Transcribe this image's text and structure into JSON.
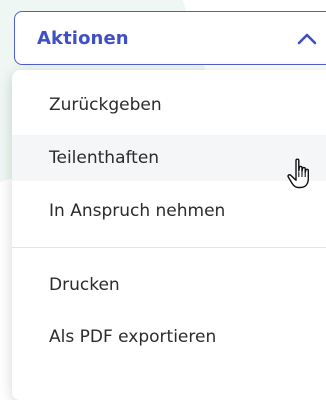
{
  "dropdown": {
    "label": "Aktionen",
    "expanded": true,
    "icon": "chevron-up-icon",
    "accent_color": "#4f5fd0"
  },
  "menu": {
    "group1": [
      {
        "label": "Zurückgeben"
      },
      {
        "label": "Teilenthaften",
        "hovered": true
      },
      {
        "label": "In Anspruch nehmen"
      }
    ],
    "group2": [
      {
        "label": "Drucken"
      },
      {
        "label": "Als PDF exportieren"
      }
    ]
  },
  "cursor": {
    "icon": "hand-pointer-icon"
  }
}
